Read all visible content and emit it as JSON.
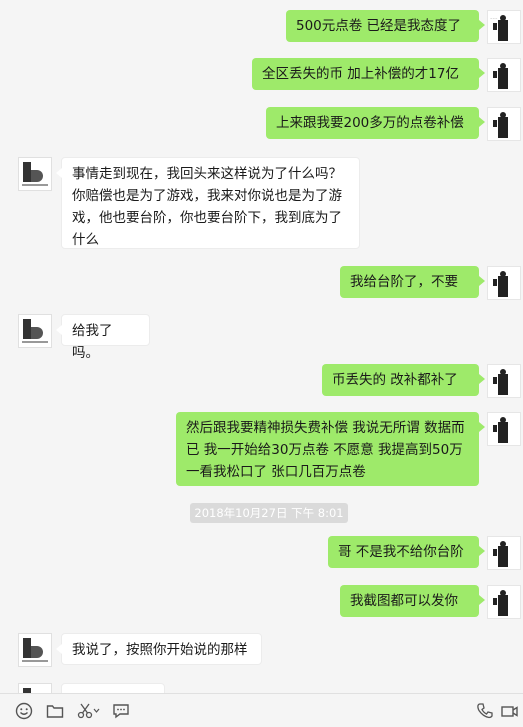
{
  "messages": [
    {
      "side": "right",
      "text": "500元点卷  已经是我态度了"
    },
    {
      "side": "right",
      "text": "全区丢失的币 加上补偿的才17亿"
    },
    {
      "side": "right",
      "text": "上来跟我要200多万的点卷补偿"
    },
    {
      "side": "left",
      "text": "事情走到现在，我回头来这样说为了什么吗？你赔偿也是为了游戏，我来对你说也是为了游戏，他也要台阶，你也要台阶下，我到底为了什么"
    },
    {
      "side": "right",
      "text": "我给台阶了，不要"
    },
    {
      "side": "left",
      "text": "给我了吗。"
    },
    {
      "side": "right",
      "text": "币丢失的 改补都补了"
    },
    {
      "side": "right",
      "text": "  然后跟我要精神损失费补偿 我说无所谓 数据而已 我一开始给30万点卷  不愿意 我提高到50万 一看我松口了 张口几百万点卷"
    },
    {
      "side": "right",
      "text": "哥 不是我不给你台阶"
    },
    {
      "side": "right",
      "text": "我截图都可以发你"
    },
    {
      "side": "left",
      "text": "我说了，按照你开始说的那样"
    },
    {
      "side": "left",
      "text": ""
    }
  ],
  "timestamp": "2018年10月27日  下午 8:01",
  "toolbar": {
    "icons": [
      "emoji-icon",
      "folder-icon",
      "scissors-icon",
      "chat-history-icon",
      "phone-icon",
      "video-call-icon"
    ]
  },
  "colors": {
    "background": "#f5f5f5",
    "my_bubble": "#9eea6a",
    "other_bubble": "#ffffff",
    "timestamp_bg": "#dadada"
  }
}
